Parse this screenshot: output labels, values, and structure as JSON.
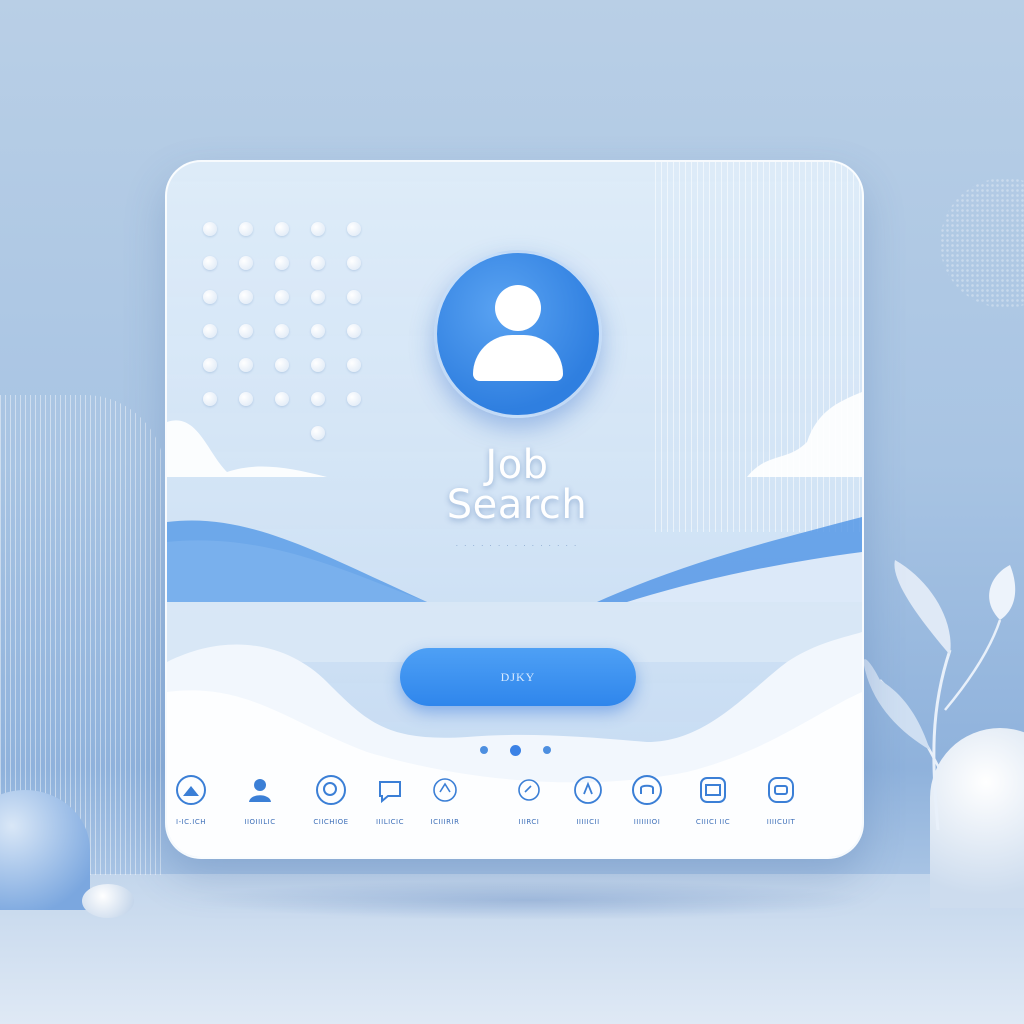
{
  "app": {
    "title_line1": "Job",
    "title_line2": "Search",
    "tagline": "· ·  · · · · · · · · · · · · ·"
  },
  "cta": {
    "label": "DJKY"
  },
  "pager": {
    "count": 3,
    "active_index": 1
  },
  "icons": [
    {
      "icon": "briefcase-icon",
      "label": "I-IC.ICH"
    },
    {
      "icon": "user-icon",
      "label": "IIOIIILIC"
    },
    {
      "icon": "search-icon",
      "label": "CIICHIOE"
    },
    {
      "icon": "chat-icon",
      "label": "IIILICIC"
    },
    {
      "icon": "location-icon",
      "label": "ICIIIRIR"
    },
    {
      "icon": "bell-icon",
      "label": "IIIRCI"
    },
    {
      "icon": "star-icon",
      "label": "IIIIICII"
    },
    {
      "icon": "folder-icon",
      "label": "IIIIIIIOI"
    },
    {
      "icon": "calendar-icon",
      "label": "CIIICI IIC"
    },
    {
      "icon": "settings-icon",
      "label": "IIIICUIT"
    }
  ],
  "colors": {
    "accent": "#2f86ec",
    "avatar": "#3b8ae6",
    "background": "#a8c4e3"
  }
}
